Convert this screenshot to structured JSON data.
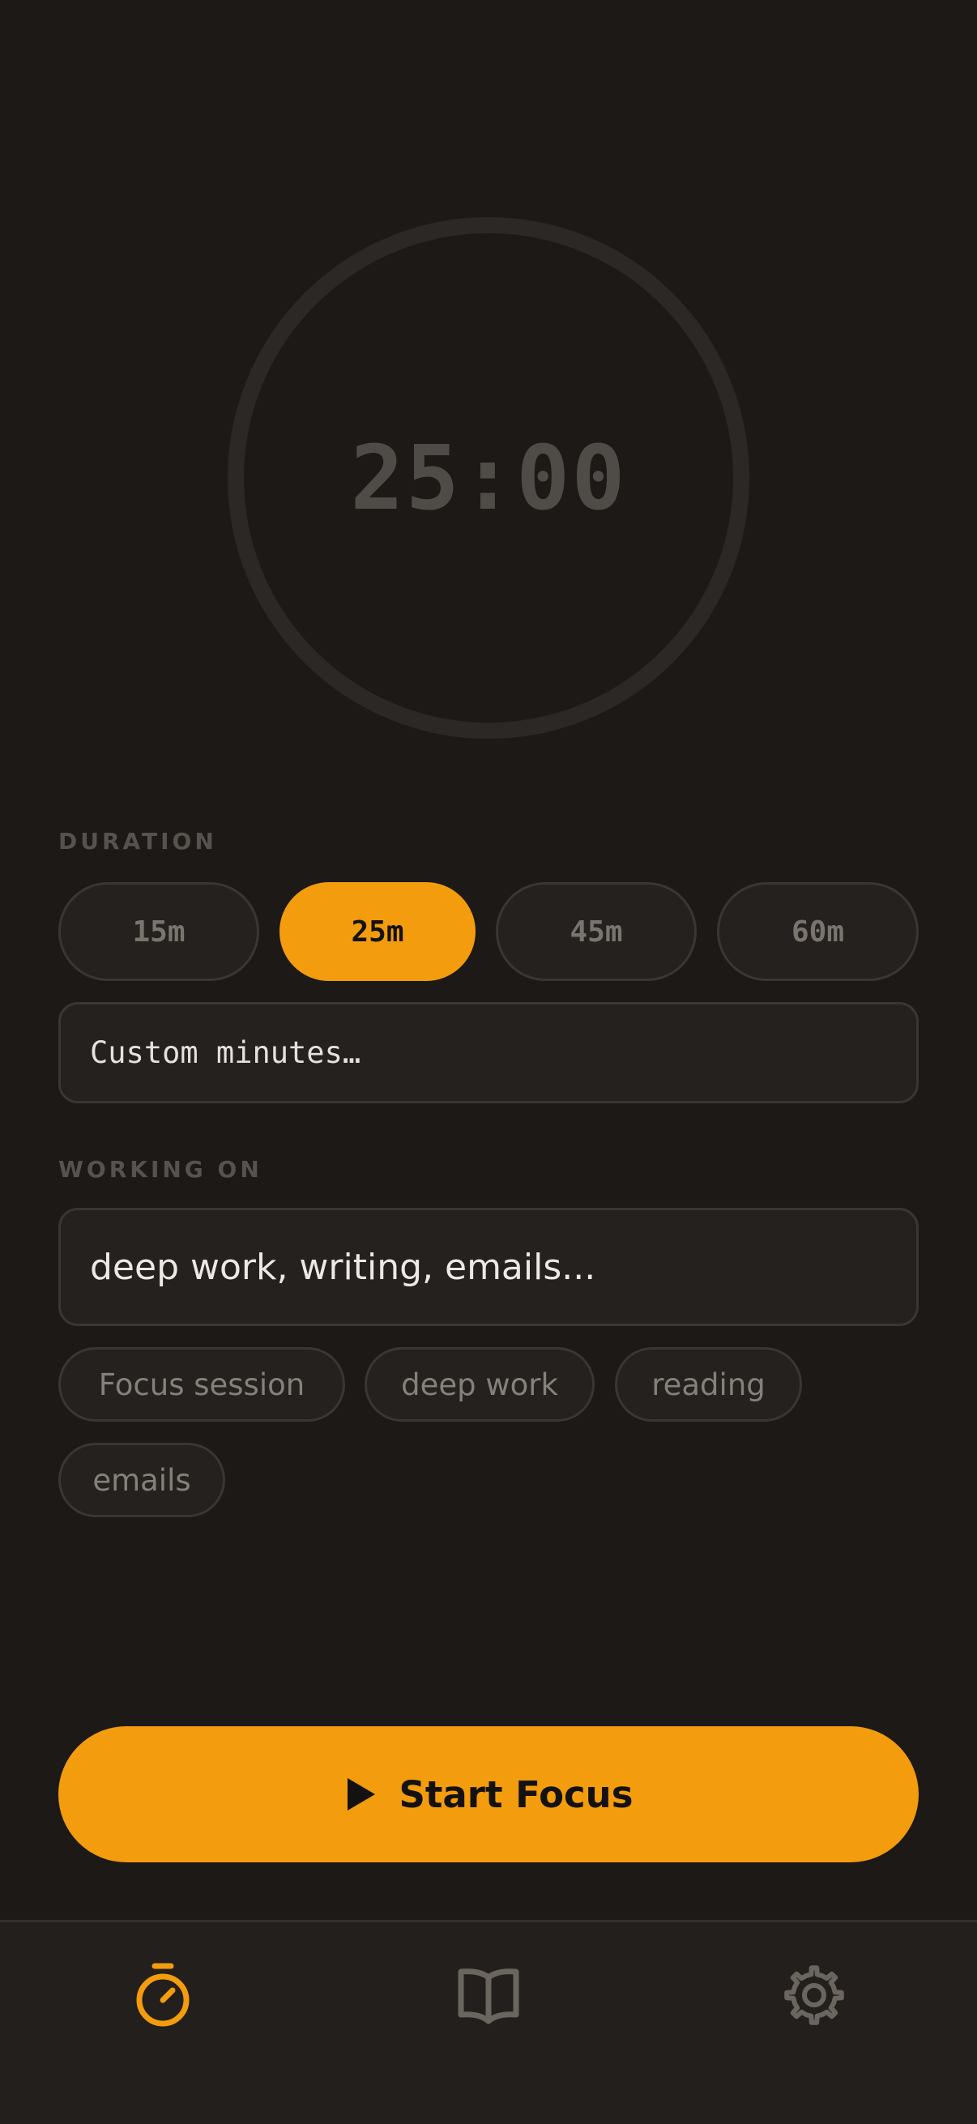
{
  "timer": {
    "display": "25:00"
  },
  "duration": {
    "label": "DURATION",
    "options": [
      {
        "label": "15m",
        "selected": false
      },
      {
        "label": "25m",
        "selected": true
      },
      {
        "label": "45m",
        "selected": false
      },
      {
        "label": "60m",
        "selected": false
      }
    ],
    "custom_placeholder": "Custom minutes…"
  },
  "working_on": {
    "label": "WORKING ON",
    "placeholder": "deep work, writing, emails...",
    "suggestions": [
      "Focus session",
      "deep work",
      "reading",
      "emails"
    ]
  },
  "start_button": {
    "label": "Start Focus",
    "icon": "play-icon"
  },
  "nav": {
    "items": [
      {
        "icon": "stopwatch-icon",
        "active": true
      },
      {
        "icon": "book-open-icon",
        "active": false
      },
      {
        "icon": "gear-icon",
        "active": false
      }
    ]
  },
  "colors": {
    "background": "#1c1917",
    "accent": "#f39c0e",
    "surface": "#24211f",
    "muted_text": "#86807a"
  }
}
